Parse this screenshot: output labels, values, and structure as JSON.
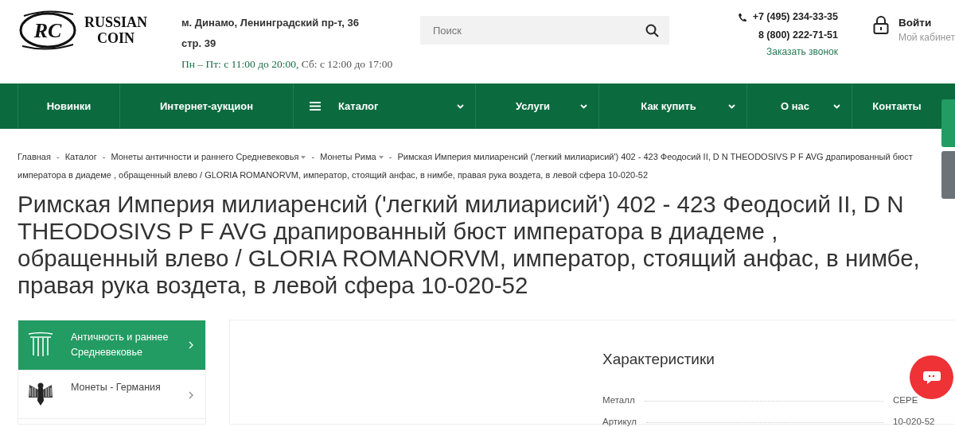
{
  "header": {
    "logo": {
      "monogram": "RC",
      "name_line1": "RUSSIAN",
      "name_line2": "COIN"
    },
    "address": "м. Динамо, Ленинградский пр-т, 36 стр. 39",
    "hours": {
      "weekdays": "Пн – Пт: с 11:00 до 20:00,",
      "saturday": "Сб: с 12:00 до 17:00"
    },
    "search": {
      "placeholder": "Поиск"
    },
    "phones": [
      "+7 (495) 234-33-35",
      "8 (800) 222-71-51"
    ],
    "callback": "Заказать звонок",
    "login": {
      "title": "Войти",
      "subtitle": "Мой кабинет"
    }
  },
  "nav": [
    {
      "label": "Новинки",
      "menu_icon": false,
      "dropdown": false
    },
    {
      "label": "Интернет-аукцион",
      "menu_icon": false,
      "dropdown": false
    },
    {
      "label": "Каталог",
      "menu_icon": true,
      "dropdown": true
    },
    {
      "label": "Услуги",
      "menu_icon": false,
      "dropdown": true
    },
    {
      "label": "Как купить",
      "menu_icon": false,
      "dropdown": true
    },
    {
      "label": "О нас",
      "menu_icon": false,
      "dropdown": true
    },
    {
      "label": "Контакты",
      "menu_icon": false,
      "dropdown": false
    }
  ],
  "breadcrumbs": [
    {
      "label": "Главная",
      "dropdown": false
    },
    {
      "label": "Каталог",
      "dropdown": false
    },
    {
      "label": "Монеты античности и раннего Средневековья",
      "dropdown": true
    },
    {
      "label": "Монеты Рима",
      "dropdown": true
    },
    {
      "lines": [
        "Римская Империя милиаренсий ('легкий милиарисий') 402 - 423 Феодосий II, D N THEODOSIVS P F AVG драпированный бюст",
        "императора в диадеме , обращенный влево / GLORIA ROMANORVM, император, стоящий анфас, в нимбе, правая рука воздета, в левой сфера 10-020-52"
      ],
      "dropdown": false
    }
  ],
  "breadcrumb_separator": "-",
  "title": "Римская Империя милиаренсий ('легкий милиарисий') 402 - 423 Феодосий II, D N THEODOSIVS P F AVG драпированный бюст императора в диадеме , обращенный влево / GLORIA ROMANORVM, император, стоящий анфас, в нимбе, правая рука воздета, в левой сфера 10-020-52",
  "sidebar": {
    "items": [
      {
        "label": "Античность и раннее Средневековье",
        "kind": "column",
        "selected": true
      },
      {
        "label": "Монеты - Германия",
        "kind": "eagle",
        "selected": false
      }
    ]
  },
  "characteristics": {
    "heading": "Характеристики",
    "rows": [
      {
        "name": "Металл",
        "value": "СЕРЕ"
      },
      {
        "name": "Артикул",
        "value": "10-020-52"
      }
    ]
  }
}
